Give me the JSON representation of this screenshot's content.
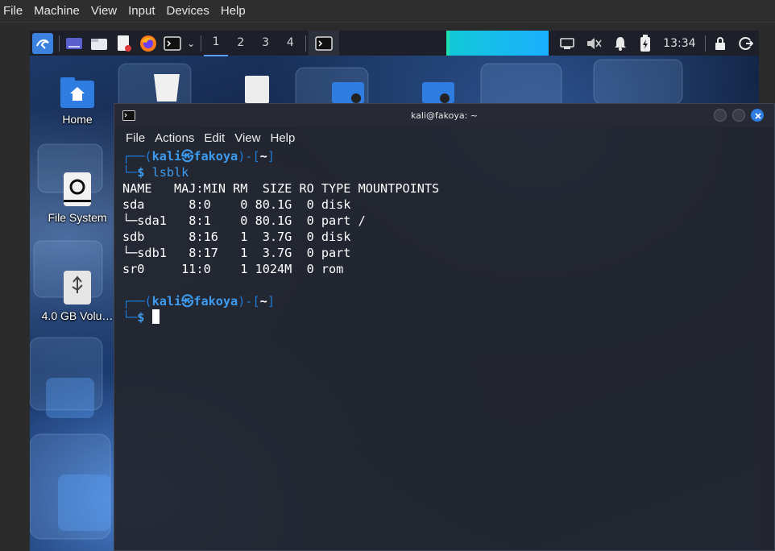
{
  "host_menu": {
    "items": [
      "File",
      "Machine",
      "View",
      "Input",
      "Devices",
      "Help"
    ]
  },
  "panel": {
    "workspaces": [
      "1",
      "2",
      "3",
      "4"
    ],
    "active_workspace": "1",
    "clock": "13:34"
  },
  "desktop": {
    "icons": [
      {
        "label": "Home",
        "icon": "home-folder-icon"
      },
      {
        "label": "File System",
        "icon": "drive-icon"
      },
      {
        "label": "4.0 GB Volu…",
        "icon": "usb-drive-icon"
      }
    ]
  },
  "terminal": {
    "title": "kali@fakoya: ~",
    "menu": [
      "File",
      "Actions",
      "Edit",
      "View",
      "Help"
    ],
    "user": "kali",
    "host": "fakoya",
    "cwd": "~",
    "command": "lsblk",
    "output": [
      "NAME   MAJ:MIN RM  SIZE RO TYPE MOUNTPOINTS",
      "sda      8:0    0 80.1G  0 disk",
      "└─sda1   8:1    0 80.1G  0 part /",
      "sdb      8:16   1  3.7G  0 disk",
      "└─sdb1   8:17   1  3.7G  0 part",
      "sr0     11:0    1 1024M  0 rom"
    ]
  },
  "colors": {
    "accent": "#3d9bf0",
    "terminal_bg": "#232630",
    "panel_bg": "#1d2029"
  }
}
